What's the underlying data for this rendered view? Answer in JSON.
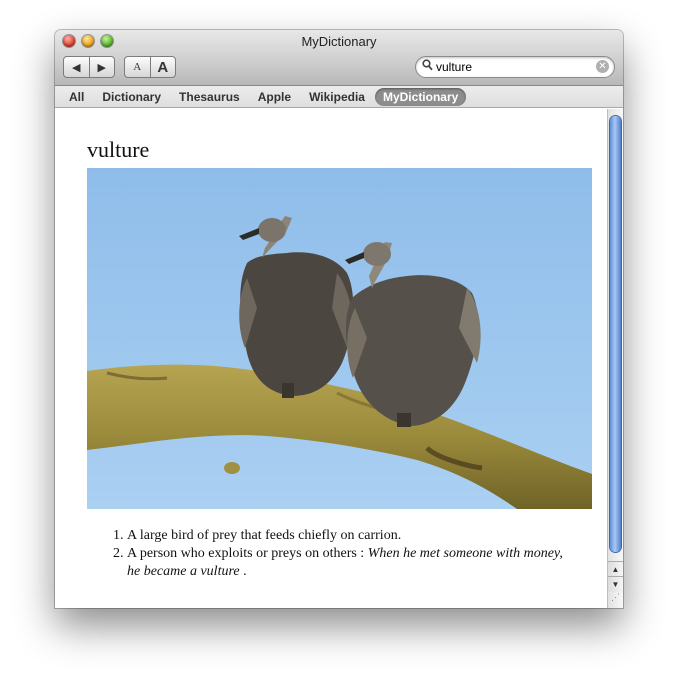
{
  "window": {
    "title": "MyDictionary"
  },
  "toolbar": {
    "back_icon": "◀",
    "forward_icon": "▶",
    "font_smaller_label": "A",
    "font_larger_label": "A"
  },
  "search": {
    "value": "vulture",
    "icon": "magnifier-icon",
    "clear_icon": "✕"
  },
  "tabs": [
    {
      "label": "All",
      "active": false
    },
    {
      "label": "Dictionary",
      "active": false
    },
    {
      "label": "Thesaurus",
      "active": false
    },
    {
      "label": "Apple",
      "active": false
    },
    {
      "label": "Wikipedia",
      "active": false
    },
    {
      "label": "MyDictionary",
      "active": true
    }
  ],
  "entry": {
    "headword": "vulture",
    "definitions": [
      {
        "number": "1.",
        "text": "A large bird of prey that feeds chiefly on carrion.",
        "example": ""
      },
      {
        "number": "2.",
        "text": "A person who exploits or preys on others : ",
        "example": "When he met someone with money, he became a vulture",
        "trailing": " ."
      }
    ]
  },
  "colors": {
    "tab_active_bg": "#8d8d8d",
    "scroll_thumb": "#5c8fd8",
    "sky": "#9cc7ef",
    "branch": "#9b8a3c"
  }
}
